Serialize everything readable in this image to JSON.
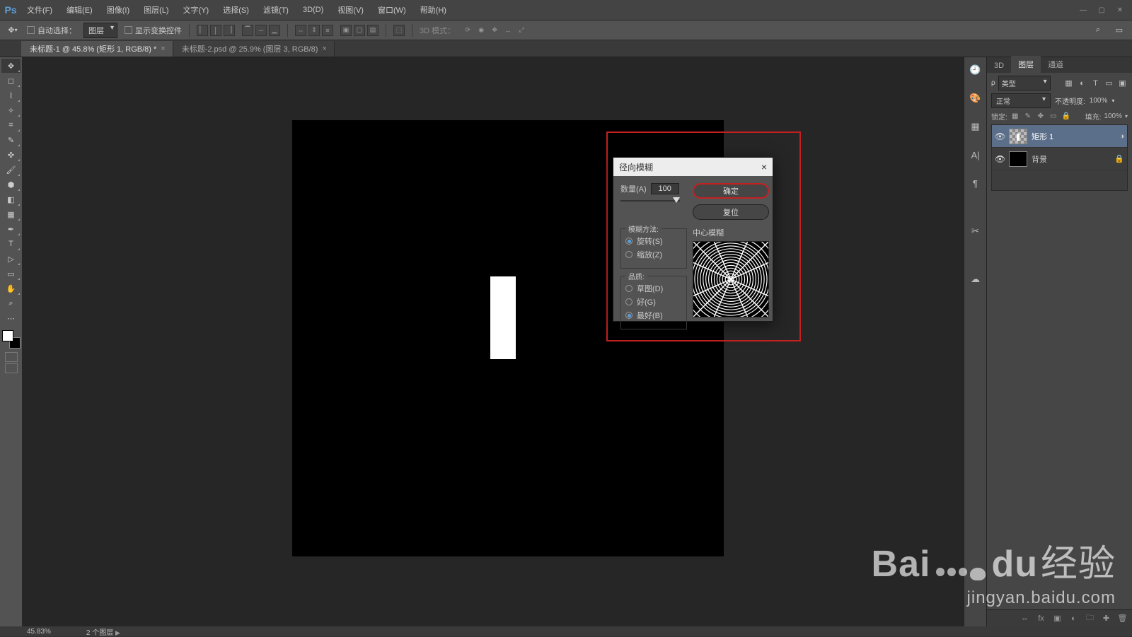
{
  "app": {
    "logo": "Ps"
  },
  "menu": {
    "items": [
      "文件(F)",
      "编辑(E)",
      "图像(I)",
      "图层(L)",
      "文字(Y)",
      "选择(S)",
      "滤镜(T)",
      "3D(D)",
      "视图(V)",
      "窗口(W)",
      "帮助(H)"
    ]
  },
  "options": {
    "auto_select_label": "自动选择：",
    "target_dropdown": "图层",
    "show_transform_label": "显示变换控件",
    "mode_3d_label": "3D 模式："
  },
  "tabs": [
    {
      "label": "未标题-1 @ 45.8% (矩形 1, RGB/8) *",
      "active": true
    },
    {
      "label": "未标题-2.psd @ 25.9% (图层 3, RGB/8)",
      "active": false
    }
  ],
  "dialog": {
    "title": "径向模糊",
    "amount_label": "数量(A)",
    "amount_value": "100",
    "ok": "确定",
    "reset": "复位",
    "method_legend": "模糊方法:",
    "method_spin": "旋转(S)",
    "method_zoom": "缩放(Z)",
    "quality_legend": "品质:",
    "quality_draft": "草图(D)",
    "quality_good": "好(G)",
    "quality_best": "最好(B)",
    "center_label": "中心模糊"
  },
  "panels": {
    "tab_3d": "3D",
    "tab_layers": "图层",
    "tab_channels": "通道",
    "filter_kind_label": "类型",
    "blend_mode": "正常",
    "opacity_label": "不透明度:",
    "opacity_value": "100%",
    "lock_label": "锁定:",
    "fill_label": "填充:",
    "fill_value": "100%",
    "layers": [
      {
        "name": "矩形 1",
        "selected": true,
        "locked": false
      },
      {
        "name": "背景",
        "selected": false,
        "locked": true
      }
    ]
  },
  "status": {
    "zoom": "45.83%",
    "info": "2 个图层"
  },
  "watermark": {
    "brand_a": "Bai",
    "brand_b": "du",
    "brand_c": "经验",
    "url": "jingyan.baidu.com"
  }
}
